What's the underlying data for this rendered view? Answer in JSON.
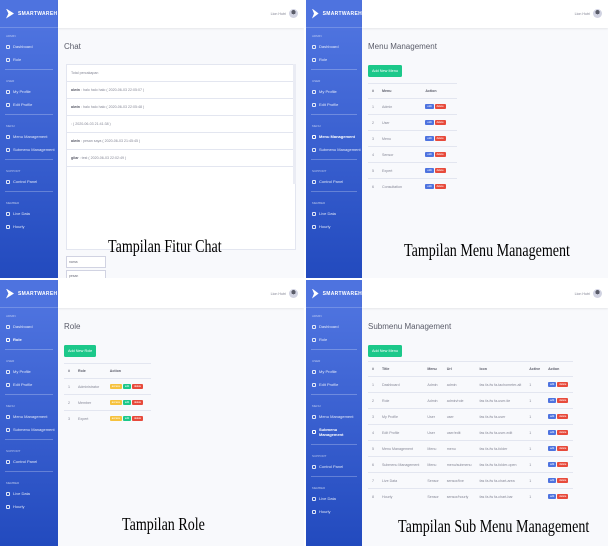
{
  "brand": "SMARTWAREH",
  "user_name": "Lion Hutri",
  "sidebar": {
    "sec_admin": "Admin",
    "sec_user": "User",
    "sec_menu": "Menu",
    "sec_support": "Support",
    "sec_member": "Member",
    "items": [
      "Dashboard",
      "Role",
      "My Profile",
      "Edit Profile",
      "Menu Management",
      "Submenu Management",
      "Control Panel",
      "Live Data",
      "Hourly"
    ]
  },
  "chat": {
    "title": "Chat",
    "subtitle": "Total percakapan",
    "messages": [
      {
        "who": "alwin",
        "text": ": halo halo halo ( 2020-06-03 22:05:07 )"
      },
      {
        "who": "alwin",
        "text": ": halo halo halo ( 2020-06-03 22:05:48 )"
      },
      {
        "who": "",
        "text": ": ( 2020-06-03 21:41:38 )"
      },
      {
        "who": "alwin",
        "text": ": pesan saya ( 2020-06-03 21:45:45 )"
      },
      {
        "who": "gilar",
        "text": ": test ( 2020-06-03 22:02:49 )"
      }
    ],
    "input_name": "nama",
    "input_msg": "pesan",
    "caption": "Tampilan Fitur Chat"
  },
  "menu_mgmt": {
    "title": "Menu Management",
    "add_label": "Add New Menu",
    "headers": [
      "#",
      "Menu",
      "Action"
    ],
    "rows": [
      [
        "1",
        "Admin"
      ],
      [
        "2",
        "User"
      ],
      [
        "3",
        "Menu"
      ],
      [
        "4",
        "Sensor"
      ],
      [
        "5",
        "Expert"
      ],
      [
        "6",
        "Consultation"
      ]
    ],
    "edit": "edit",
    "delete": "delete",
    "caption": "Tampilan Menu Management"
  },
  "role": {
    "title": "Role",
    "add_label": "Add New Role",
    "headers": [
      "#",
      "Role",
      "Action"
    ],
    "rows": [
      [
        "1",
        "Administrator"
      ],
      [
        "2",
        "Member"
      ],
      [
        "3",
        "Expert"
      ]
    ],
    "access": "access",
    "edit": "edit",
    "delete": "delete",
    "caption": "Tampilan Role"
  },
  "submenu": {
    "title": "Submenu Management",
    "add_label": "Add New Menu",
    "headers": [
      "#",
      "Title",
      "Menu",
      "Url",
      "Icon",
      "Active",
      "Action"
    ],
    "rows": [
      [
        "1",
        "Dashboard",
        "Admin",
        "admin",
        "fas fa-fw fa-tachometer-alt",
        "1"
      ],
      [
        "2",
        "Role",
        "Admin",
        "admin/role",
        "fas fa-fw fa-user-tie",
        "1"
      ],
      [
        "3",
        "My Profile",
        "User",
        "user",
        "fas fa-fw fa-user",
        "1"
      ],
      [
        "4",
        "Edit Profile",
        "User",
        "user/edit",
        "fas fa-fw fa-user-edit",
        "1"
      ],
      [
        "5",
        "Menu Management",
        "Menu",
        "menu",
        "fas fa-fw fa-folder",
        "1"
      ],
      [
        "6",
        "Submenu Management",
        "Menu",
        "menu/submenu",
        "fas fa-fw fa-folder-open",
        "1"
      ],
      [
        "7",
        "Live Data",
        "Sensor",
        "sensor/live",
        "fas fa-fw fa-chart-area",
        "1"
      ],
      [
        "8",
        "Hourly",
        "Sensor",
        "sensor/hourly",
        "fas fa-fw fa-chart-bar",
        "1"
      ]
    ],
    "edit": "edit",
    "delete": "delete",
    "caption": "Tampilan Sub Menu Management"
  }
}
